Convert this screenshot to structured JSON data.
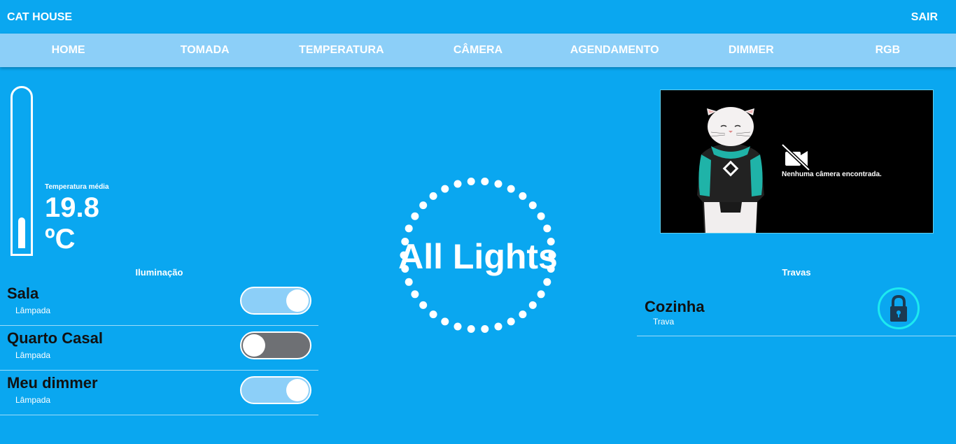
{
  "header": {
    "brand": "CAT HOUSE",
    "logout_label": "SAIR"
  },
  "nav": [
    {
      "label": "HOME"
    },
    {
      "label": "TOMADA"
    },
    {
      "label": "TEMPERATURA"
    },
    {
      "label": "CÂMERA"
    },
    {
      "label": "AGENDAMENTO"
    },
    {
      "label": "DIMMER"
    },
    {
      "label": "RGB"
    }
  ],
  "temperature": {
    "label": "Temperatura média",
    "value": "19.8",
    "unit": "ºC",
    "thermometer_level": 0.2
  },
  "lighting": {
    "title": "Iluminação",
    "items": [
      {
        "name": "Sala",
        "type": "Lâmpada",
        "on": true
      },
      {
        "name": "Quarto Casal",
        "type": "Lâmpada",
        "on": false
      },
      {
        "name": "Meu dimmer",
        "type": "Lâmpada",
        "on": true
      }
    ]
  },
  "all_lights": {
    "label": "All Lights"
  },
  "camera": {
    "message": "Nenhuma câmera encontrada."
  },
  "locks": {
    "title": "Travas",
    "items": [
      {
        "name": "Cozinha",
        "type": "Trava"
      }
    ]
  },
  "colors": {
    "background": "#0aa7f0",
    "navbar": "#8ccff8",
    "toggle_on": "#8ccff8",
    "toggle_off": "#6e7074",
    "lock_ring": "#1de9f0",
    "lock_icon": "#1c3a52"
  }
}
